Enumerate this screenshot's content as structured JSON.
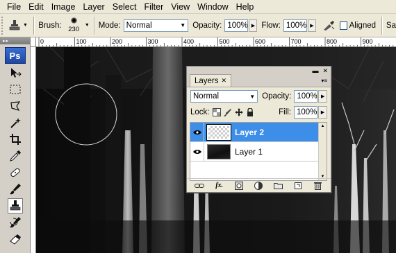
{
  "menu": [
    "File",
    "Edit",
    "Image",
    "Layer",
    "Select",
    "Filter",
    "View",
    "Window",
    "Help"
  ],
  "options": {
    "brush_label": "Brush:",
    "brush_size": "230",
    "mode_label": "Mode:",
    "mode_value": "Normal",
    "opacity_label": "Opacity:",
    "opacity_value": "100%",
    "flow_label": "Flow:",
    "flow_value": "100%",
    "aligned_label": "Aligned",
    "sample_label": "Sa"
  },
  "tools": {
    "logo": "Ps",
    "items": [
      "move-icon",
      "marquee-icon",
      "lasso-icon",
      "magic-wand-icon",
      "crop-icon",
      "eyedropper-icon",
      "healing-icon",
      "brush-icon",
      "clone-stamp-icon",
      "history-brush-icon",
      "eraser-icon"
    ],
    "active": "clone-stamp-icon"
  },
  "ruler": {
    "labels": [
      "0",
      "100",
      "200",
      "300",
      "400",
      "500",
      "600",
      "700",
      "800",
      "900"
    ]
  },
  "layers_panel": {
    "tab_label": "Layers",
    "blend_mode": "Normal",
    "opacity_label": "Opacity:",
    "opacity_value": "100%",
    "lock_label": "Lock:",
    "fill_label": "Fill:",
    "fill_value": "100%",
    "layers": [
      {
        "name": "Layer 2",
        "selected": true,
        "visible": true
      },
      {
        "name": "Layer 1",
        "selected": false,
        "visible": true
      }
    ],
    "footer_icons": [
      "link-icon",
      "fx-icon",
      "mask-icon",
      "adjustment-icon",
      "group-icon",
      "new-layer-icon",
      "trash-icon"
    ],
    "fx_label": "fx."
  },
  "colors": {
    "selection": "#3d8ee8",
    "chrome": "#ece9d8",
    "logo": "#1d48a5"
  }
}
